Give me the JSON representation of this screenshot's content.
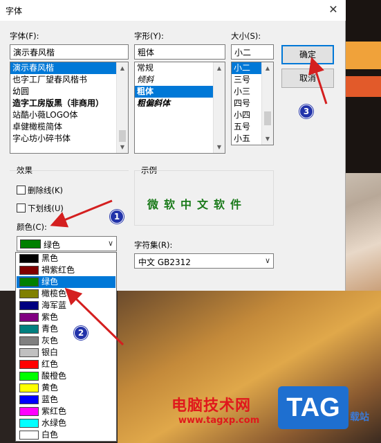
{
  "window": {
    "title": "字体",
    "close": "✕"
  },
  "font": {
    "label": "字体(F):",
    "value": "演示春风楷",
    "items": [
      "演示春风楷",
      "也字工厂望春风楷书",
      "幼圆",
      "造字工房版黑（非商用）",
      "站酷小薇LOGO体",
      "卓健橄榄简体",
      "字心坊小碎书体"
    ],
    "selected": 0
  },
  "style": {
    "label": "字形(Y):",
    "value": "粗体",
    "items": [
      "常规",
      "倾斜",
      "粗体",
      "粗偏斜体"
    ],
    "selected": 2
  },
  "size": {
    "label": "大小(S):",
    "value": "小二",
    "items": [
      "小二",
      "三号",
      "小三",
      "四号",
      "小四",
      "五号",
      "小五"
    ],
    "selected": 0
  },
  "buttons": {
    "ok": "确定",
    "cancel": "取消"
  },
  "effects": {
    "group": "效果",
    "strikeout": "删除线(K)",
    "underline": "下划线(U)",
    "color_label": "颜色(C):",
    "color_value": "绿色",
    "color_swatch": "#008000"
  },
  "sample": {
    "group": "示例",
    "text": "微软中文软件"
  },
  "charset": {
    "label": "字符集(R):",
    "value": "中文 GB2312"
  },
  "colors": [
    {
      "name": "黑色",
      "hex": "#000000"
    },
    {
      "name": "褐紫红色",
      "hex": "#800000"
    },
    {
      "name": "绿色",
      "hex": "#008000"
    },
    {
      "name": "橄榄色",
      "hex": "#808000"
    },
    {
      "name": "海军蓝",
      "hex": "#000080"
    },
    {
      "name": "紫色",
      "hex": "#800080"
    },
    {
      "name": "青色",
      "hex": "#008080"
    },
    {
      "name": "灰色",
      "hex": "#808080"
    },
    {
      "name": "银白",
      "hex": "#c0c0c0"
    },
    {
      "name": "红色",
      "hex": "#ff0000"
    },
    {
      "name": "酸橙色",
      "hex": "#00ff00"
    },
    {
      "name": "黄色",
      "hex": "#ffff00"
    },
    {
      "name": "蓝色",
      "hex": "#0000ff"
    },
    {
      "name": "紫红色",
      "hex": "#ff00ff"
    },
    {
      "name": "水绿色",
      "hex": "#00ffff"
    },
    {
      "name": "白色",
      "hex": "#ffffff"
    }
  ],
  "colors_selected": 2,
  "annotations": [
    "1",
    "2",
    "3"
  ],
  "watermark": {
    "site_cn": "电脑技术网",
    "url": "www.tagxp.com",
    "logo": "TAG",
    "tail": "载站"
  }
}
